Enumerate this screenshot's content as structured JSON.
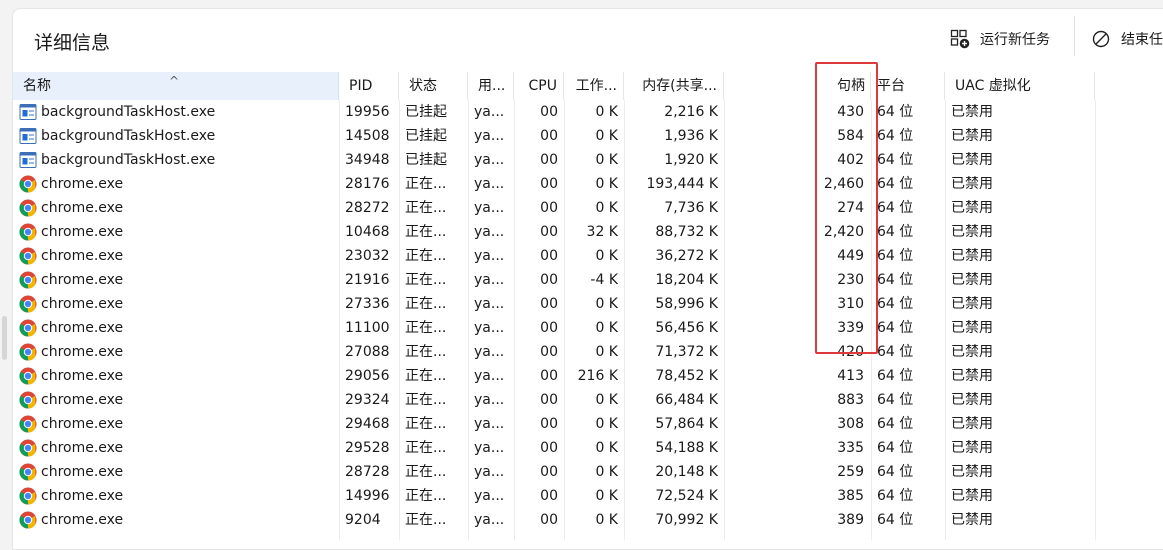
{
  "panel": {
    "title": "详细信息",
    "run_task_label": "运行新任务",
    "end_task_label": "结束任"
  },
  "columns": [
    {
      "key": "name",
      "label": "名称"
    },
    {
      "key": "pid",
      "label": "PID"
    },
    {
      "key": "status",
      "label": "状态"
    },
    {
      "key": "user",
      "label": "用..."
    },
    {
      "key": "cpu",
      "label": "CPU"
    },
    {
      "key": "ws",
      "label": "工作..."
    },
    {
      "key": "mem",
      "label": "内存(共享..."
    },
    {
      "key": "handles",
      "label": "句柄"
    },
    {
      "key": "platform",
      "label": "平台"
    },
    {
      "key": "uac",
      "label": "UAC 虚拟化"
    }
  ],
  "sort": {
    "column": "name",
    "direction": "ascending",
    "glyph": "^"
  },
  "rows": [
    {
      "icon": "background-task-host-icon",
      "name": "backgroundTaskHost.exe",
      "pid": "19956",
      "status": "已挂起",
      "user": "ya...",
      "cpu": "00",
      "ws": "0 K",
      "mem": "2,216 K",
      "handles": "430",
      "platform": "64 位",
      "uac": "已禁用"
    },
    {
      "icon": "background-task-host-icon",
      "name": "backgroundTaskHost.exe",
      "pid": "14508",
      "status": "已挂起",
      "user": "ya...",
      "cpu": "00",
      "ws": "0 K",
      "mem": "1,936 K",
      "handles": "584",
      "platform": "64 位",
      "uac": "已禁用"
    },
    {
      "icon": "background-task-host-icon",
      "name": "backgroundTaskHost.exe",
      "pid": "34948",
      "status": "已挂起",
      "user": "ya...",
      "cpu": "00",
      "ws": "0 K",
      "mem": "1,920 K",
      "handles": "402",
      "platform": "64 位",
      "uac": "已禁用"
    },
    {
      "icon": "chrome-icon",
      "name": "chrome.exe",
      "pid": "28176",
      "status": "正在...",
      "user": "ya...",
      "cpu": "00",
      "ws": "0 K",
      "mem": "193,444 K",
      "handles": "2,460",
      "platform": "64 位",
      "uac": "已禁用"
    },
    {
      "icon": "chrome-icon",
      "name": "chrome.exe",
      "pid": "28272",
      "status": "正在...",
      "user": "ya...",
      "cpu": "00",
      "ws": "0 K",
      "mem": "7,736 K",
      "handles": "274",
      "platform": "64 位",
      "uac": "已禁用"
    },
    {
      "icon": "chrome-icon",
      "name": "chrome.exe",
      "pid": "10468",
      "status": "正在...",
      "user": "ya...",
      "cpu": "00",
      "ws": "32 K",
      "mem": "88,732 K",
      "handles": "2,420",
      "platform": "64 位",
      "uac": "已禁用"
    },
    {
      "icon": "chrome-icon",
      "name": "chrome.exe",
      "pid": "23032",
      "status": "正在...",
      "user": "ya...",
      "cpu": "00",
      "ws": "0 K",
      "mem": "36,272 K",
      "handles": "449",
      "platform": "64 位",
      "uac": "已禁用"
    },
    {
      "icon": "chrome-icon",
      "name": "chrome.exe",
      "pid": "21916",
      "status": "正在...",
      "user": "ya...",
      "cpu": "00",
      "ws": "-4 K",
      "mem": "18,204 K",
      "handles": "230",
      "platform": "64 位",
      "uac": "已禁用"
    },
    {
      "icon": "chrome-icon",
      "name": "chrome.exe",
      "pid": "27336",
      "status": "正在...",
      "user": "ya...",
      "cpu": "00",
      "ws": "0 K",
      "mem": "58,996 K",
      "handles": "310",
      "platform": "64 位",
      "uac": "已禁用"
    },
    {
      "icon": "chrome-icon",
      "name": "chrome.exe",
      "pid": "11100",
      "status": "正在...",
      "user": "ya...",
      "cpu": "00",
      "ws": "0 K",
      "mem": "56,456 K",
      "handles": "339",
      "platform": "64 位",
      "uac": "已禁用"
    },
    {
      "icon": "chrome-icon",
      "name": "chrome.exe",
      "pid": "27088",
      "status": "正在...",
      "user": "ya...",
      "cpu": "00",
      "ws": "0 K",
      "mem": "71,372 K",
      "handles": "420",
      "platform": "64 位",
      "uac": "已禁用"
    },
    {
      "icon": "chrome-icon",
      "name": "chrome.exe",
      "pid": "29056",
      "status": "正在...",
      "user": "ya...",
      "cpu": "00",
      "ws": "216 K",
      "mem": "78,452 K",
      "handles": "413",
      "platform": "64 位",
      "uac": "已禁用"
    },
    {
      "icon": "chrome-icon",
      "name": "chrome.exe",
      "pid": "29324",
      "status": "正在...",
      "user": "ya...",
      "cpu": "00",
      "ws": "0 K",
      "mem": "66,484 K",
      "handles": "883",
      "platform": "64 位",
      "uac": "已禁用"
    },
    {
      "icon": "chrome-icon",
      "name": "chrome.exe",
      "pid": "29468",
      "status": "正在...",
      "user": "ya...",
      "cpu": "00",
      "ws": "0 K",
      "mem": "57,864 K",
      "handles": "308",
      "platform": "64 位",
      "uac": "已禁用"
    },
    {
      "icon": "chrome-icon",
      "name": "chrome.exe",
      "pid": "29528",
      "status": "正在...",
      "user": "ya...",
      "cpu": "00",
      "ws": "0 K",
      "mem": "54,188 K",
      "handles": "335",
      "platform": "64 位",
      "uac": "已禁用"
    },
    {
      "icon": "chrome-icon",
      "name": "chrome.exe",
      "pid": "28728",
      "status": "正在...",
      "user": "ya...",
      "cpu": "00",
      "ws": "0 K",
      "mem": "20,148 K",
      "handles": "259",
      "platform": "64 位",
      "uac": "已禁用"
    },
    {
      "icon": "chrome-icon",
      "name": "chrome.exe",
      "pid": "14996",
      "status": "正在...",
      "user": "ya...",
      "cpu": "00",
      "ws": "0 K",
      "mem": "72,524 K",
      "handles": "385",
      "platform": "64 位",
      "uac": "已禁用"
    },
    {
      "icon": "chrome-icon",
      "name": "chrome.exe",
      "pid": "9204",
      "status": "正在...",
      "user": "ya...",
      "cpu": "00",
      "ws": "0 K",
      "mem": "70,992 K",
      "handles": "389",
      "platform": "64 位",
      "uac": "已禁用"
    }
  ],
  "colors": {
    "selected_header_bg": "#e8f1fb",
    "highlight_box": "#e0393b",
    "chrome_red": "#db4437",
    "chrome_yellow": "#f4b400",
    "chrome_green": "#0f9d58",
    "chrome_blue": "#4285f4"
  }
}
